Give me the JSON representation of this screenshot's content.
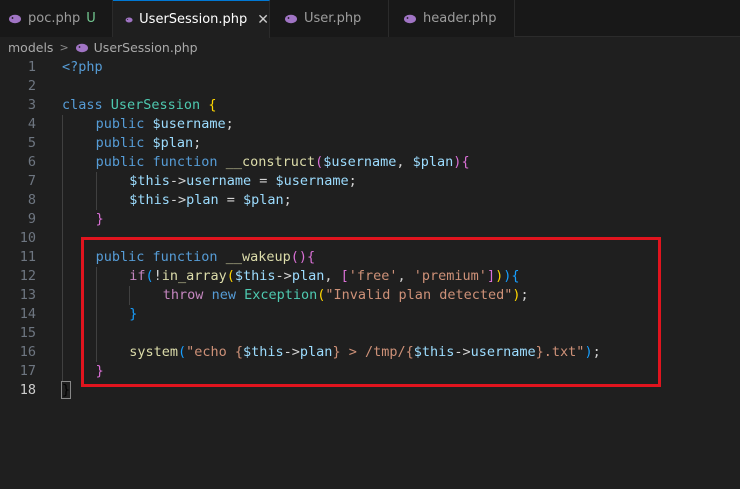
{
  "tabs": [
    {
      "label": "poc.php",
      "modified": "U",
      "active": false
    },
    {
      "label": "UserSession.php",
      "active": true,
      "close": "✕"
    },
    {
      "label": "User.php",
      "active": false
    },
    {
      "label": "header.php",
      "active": false
    }
  ],
  "breadcrumb": {
    "folder": "models",
    "separator": ">",
    "file": "UserSession.php"
  },
  "icon": {
    "php": "php-elephant-icon",
    "color": "#a074c4"
  },
  "lines": [
    {
      "n": "1",
      "indent": 0,
      "tokens": [
        [
          "tag",
          "<?php"
        ]
      ]
    },
    {
      "n": "2",
      "indent": 0,
      "tokens": []
    },
    {
      "n": "3",
      "indent": 0,
      "tokens": [
        [
          "kw",
          "class"
        ],
        [
          "op",
          " "
        ],
        [
          "cls",
          "UserSession"
        ],
        [
          "op",
          " "
        ],
        [
          "b1",
          "{"
        ]
      ]
    },
    {
      "n": "4",
      "indent": 1,
      "tokens": [
        [
          "kw",
          "public"
        ],
        [
          "op",
          " "
        ],
        [
          "var",
          "$username"
        ],
        [
          "op",
          ";"
        ]
      ]
    },
    {
      "n": "5",
      "indent": 1,
      "tokens": [
        [
          "kw",
          "public"
        ],
        [
          "op",
          " "
        ],
        [
          "var",
          "$plan"
        ],
        [
          "op",
          ";"
        ]
      ]
    },
    {
      "n": "6",
      "indent": 1,
      "tokens": [
        [
          "kw",
          "public"
        ],
        [
          "op",
          " "
        ],
        [
          "kw",
          "function"
        ],
        [
          "op",
          " "
        ],
        [
          "fn",
          "__construct"
        ],
        [
          "b2",
          "("
        ],
        [
          "var",
          "$username"
        ],
        [
          "op",
          ", "
        ],
        [
          "var",
          "$plan"
        ],
        [
          "b2",
          ")"
        ],
        [
          "b2",
          "{"
        ]
      ]
    },
    {
      "n": "7",
      "indent": 2,
      "tokens": [
        [
          "var",
          "$this"
        ],
        [
          "op",
          "->"
        ],
        [
          "var",
          "username"
        ],
        [
          "op",
          " = "
        ],
        [
          "var",
          "$username"
        ],
        [
          "op",
          ";"
        ]
      ]
    },
    {
      "n": "8",
      "indent": 2,
      "tokens": [
        [
          "var",
          "$this"
        ],
        [
          "op",
          "->"
        ],
        [
          "var",
          "plan"
        ],
        [
          "op",
          " = "
        ],
        [
          "var",
          "$plan"
        ],
        [
          "op",
          ";"
        ]
      ]
    },
    {
      "n": "9",
      "indent": 1,
      "tokens": [
        [
          "b2",
          "}"
        ]
      ]
    },
    {
      "n": "10",
      "indent": 1,
      "tokens": []
    },
    {
      "n": "11",
      "indent": 1,
      "tokens": [
        [
          "kw",
          "public"
        ],
        [
          "op",
          " "
        ],
        [
          "kw",
          "function"
        ],
        [
          "op",
          " "
        ],
        [
          "fn",
          "__wakeup"
        ],
        [
          "b2",
          "("
        ],
        [
          "b2",
          ")"
        ],
        [
          "b2",
          "{"
        ]
      ]
    },
    {
      "n": "12",
      "indent": 2,
      "tokens": [
        [
          "ctl",
          "if"
        ],
        [
          "b3",
          "("
        ],
        [
          "op",
          "!"
        ],
        [
          "fn",
          "in_array"
        ],
        [
          "b1",
          "("
        ],
        [
          "var",
          "$this"
        ],
        [
          "op",
          "->"
        ],
        [
          "var",
          "plan"
        ],
        [
          "op",
          ", "
        ],
        [
          "b2",
          "["
        ],
        [
          "str",
          "'free'"
        ],
        [
          "op",
          ", "
        ],
        [
          "str",
          "'premium'"
        ],
        [
          "b2",
          "]"
        ],
        [
          "b1",
          ")"
        ],
        [
          "b3",
          ")"
        ],
        [
          "b3",
          "{"
        ]
      ]
    },
    {
      "n": "13",
      "indent": 3,
      "tokens": [
        [
          "ctl",
          "throw"
        ],
        [
          "op",
          " "
        ],
        [
          "kw",
          "new"
        ],
        [
          "op",
          " "
        ],
        [
          "cls",
          "Exception"
        ],
        [
          "b1",
          "("
        ],
        [
          "str",
          "\"Invalid plan detected\""
        ],
        [
          "b1",
          ")"
        ],
        [
          "op",
          ";"
        ]
      ]
    },
    {
      "n": "14",
      "indent": 2,
      "tokens": [
        [
          "b3",
          "}"
        ]
      ]
    },
    {
      "n": "15",
      "indent": 2,
      "tokens": []
    },
    {
      "n": "16",
      "indent": 2,
      "tokens": [
        [
          "fn",
          "system"
        ],
        [
          "b3",
          "("
        ],
        [
          "str",
          "\"echo {"
        ],
        [
          "var",
          "$this"
        ],
        [
          "op",
          "->"
        ],
        [
          "var",
          "plan"
        ],
        [
          "str",
          "} > /tmp/{"
        ],
        [
          "var",
          "$this"
        ],
        [
          "op",
          "->"
        ],
        [
          "var",
          "username"
        ],
        [
          "str",
          "}.txt\""
        ],
        [
          "b3",
          ")"
        ],
        [
          "op",
          ";"
        ]
      ]
    },
    {
      "n": "17",
      "indent": 1,
      "tokens": [
        [
          "b2",
          "}"
        ]
      ]
    },
    {
      "n": "18",
      "indent": 0,
      "current": true,
      "tokens": [
        [
          "bm",
          "}"
        ]
      ]
    }
  ]
}
